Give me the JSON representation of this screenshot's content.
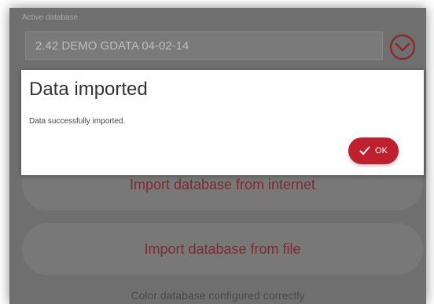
{
  "active_database": {
    "label": "Active database",
    "value": "2.42  DEMO GDATA 04-02-14"
  },
  "buttons": {
    "import_internet": "Import database from internet",
    "import_file": "Import database from file"
  },
  "status_text": "Color database configured correctly",
  "dialog": {
    "title": "Data imported",
    "message": "Data successfully imported.",
    "ok_label": "OK"
  },
  "colors": {
    "accent": "#c0202e",
    "overlay": "#6f6f6f"
  },
  "icons": {
    "dropdown": "chevron-down-circle-icon",
    "ok": "checkmark-icon"
  }
}
